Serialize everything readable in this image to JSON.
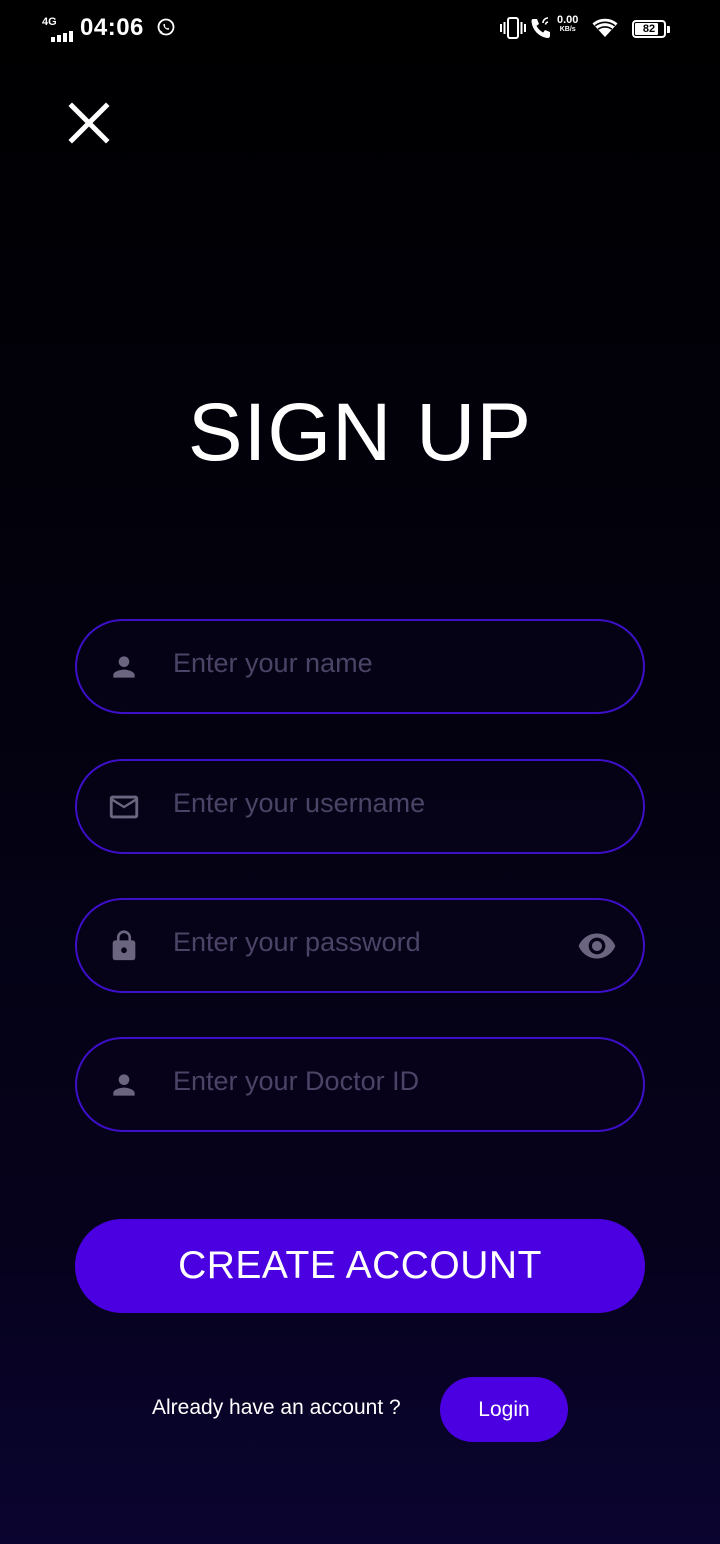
{
  "status_bar": {
    "network": "4G",
    "time": "04:06",
    "speed_value": "0.00",
    "speed_unit": "KB/s",
    "battery": "82",
    "battery_level": 0.82,
    "icons": [
      "signal-icon",
      "whatsapp-icon",
      "vibrate-icon",
      "wifi-call-icon",
      "wifi-icon",
      "battery-icon"
    ]
  },
  "header": {
    "close_icon": "close-icon"
  },
  "title": "SIGN UP",
  "form": {
    "name": {
      "placeholder": "Enter your name",
      "value": "",
      "icon": "person-icon"
    },
    "username": {
      "placeholder": "Enter your username",
      "value": "",
      "icon": "mail-icon"
    },
    "password": {
      "placeholder": "Enter your password",
      "value": "",
      "icon": "lock-icon",
      "toggle_icon": "eye-icon"
    },
    "doctor_id": {
      "placeholder": "Enter your Doctor ID",
      "value": "",
      "icon": "person-icon"
    }
  },
  "create_button": "CREATE ACCOUNT",
  "footer": {
    "prompt": "Already have an account ?",
    "login_label": "Login"
  },
  "colors": {
    "accent": "#4a00e0",
    "field_border": "#3d0fc9",
    "placeholder": "#4b4466",
    "icon": "#6b6580",
    "background_top": "#000000",
    "background_bottom": "#0a0430"
  }
}
